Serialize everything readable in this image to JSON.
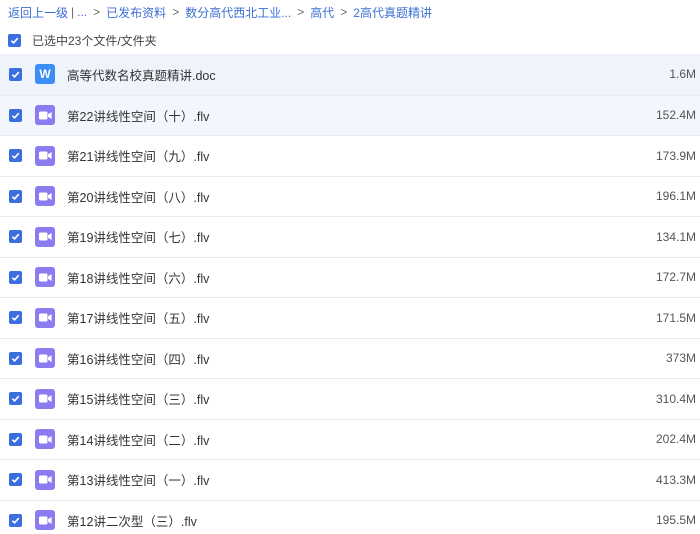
{
  "breadcrumb": {
    "back": "返回上一级",
    "divider": "|",
    "ellipsis": "...",
    "items": [
      "已发布资料",
      "数分高代西北工业...",
      "高代"
    ],
    "current": "2高代真题精讲",
    "sep": ">"
  },
  "selection": {
    "label": "已选中23个文件/文件夹"
  },
  "files": [
    {
      "name": "高等代数名校真题精讲.doc",
      "size": "1.6M",
      "type": "doc",
      "icon": "word-doc-icon",
      "icon_text": "W"
    },
    {
      "name": "第22讲线性空间（十）.flv",
      "size": "152.4M",
      "type": "video",
      "icon": "video-file-icon"
    },
    {
      "name": "第21讲线性空间（九）.flv",
      "size": "173.9M",
      "type": "video",
      "icon": "video-file-icon"
    },
    {
      "name": "第20讲线性空间（八）.flv",
      "size": "196.1M",
      "type": "video",
      "icon": "video-file-icon"
    },
    {
      "name": "第19讲线性空间（七）.flv",
      "size": "134.1M",
      "type": "video",
      "icon": "video-file-icon"
    },
    {
      "name": "第18讲线性空间（六）.flv",
      "size": "172.7M",
      "type": "video",
      "icon": "video-file-icon"
    },
    {
      "name": "第17讲线性空间（五）.flv",
      "size": "171.5M",
      "type": "video",
      "icon": "video-file-icon"
    },
    {
      "name": "第16讲线性空间（四）.flv",
      "size": "373M",
      "type": "video",
      "icon": "video-file-icon"
    },
    {
      "name": "第15讲线性空间（三）.flv",
      "size": "310.4M",
      "type": "video",
      "icon": "video-file-icon"
    },
    {
      "name": "第14讲线性空间（二）.flv",
      "size": "202.4M",
      "type": "video",
      "icon": "video-file-icon"
    },
    {
      "name": "第13讲线性空间（一）.flv",
      "size": "413.3M",
      "type": "video",
      "icon": "video-file-icon"
    },
    {
      "name": "第12讲二次型（三）.flv",
      "size": "195.5M",
      "type": "video",
      "icon": "video-file-icon"
    }
  ],
  "colors": {
    "accent": "#3b6fe0",
    "link": "#3d6fd6",
    "video_icon": "#8b7cf0",
    "doc_icon": "#3b8ef5"
  }
}
